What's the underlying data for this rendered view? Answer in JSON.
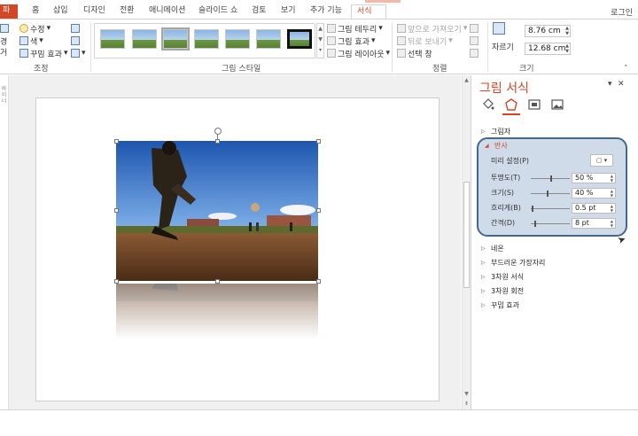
{
  "tabs": [
    {
      "label": "파일",
      "id": "file"
    },
    {
      "label": "홈",
      "id": "home"
    },
    {
      "label": "삽입",
      "id": "insert"
    },
    {
      "label": "디자인",
      "id": "design"
    },
    {
      "label": "전환",
      "id": "transitions"
    },
    {
      "label": "애니메이션",
      "id": "animations"
    },
    {
      "label": "슬라이드 쇼",
      "id": "slideshow"
    },
    {
      "label": "검토",
      "id": "review"
    },
    {
      "label": "보기",
      "id": "view"
    },
    {
      "label": "추가 기능",
      "id": "addins"
    },
    {
      "label": "서식",
      "id": "format"
    }
  ],
  "login_label": "로그인",
  "ribbon": {
    "adjust": {
      "label": "조정",
      "left_partial": [
        "경",
        "거"
      ],
      "corrections": "수정",
      "color": "색",
      "artistic": "꾸밈 효과"
    },
    "styles": {
      "label": "그림 스타일",
      "border": "그림 테두리",
      "effects": "그림 효과",
      "layout": "그림 레이아웃"
    },
    "arrange": {
      "label": "정렬",
      "bring_forward": "앞으로 가져오기",
      "send_backward": "뒤로 보내기",
      "selection_pane": "선택 창"
    },
    "size": {
      "label": "크기",
      "crop": "자르기",
      "height": "8.76 cm",
      "width": "12.68 cm"
    }
  },
  "left_strip_text": "바이너",
  "pane": {
    "title": "그림 서식",
    "close": "✕",
    "menu": "▾",
    "sections_top": [
      {
        "label": "그림자"
      }
    ],
    "reflection": {
      "label": "반사",
      "preset_label": "미리 설정(P)",
      "rows": [
        {
          "label": "투명도(T)",
          "value": "50 %",
          "fraction": 0.5
        },
        {
          "label": "크기(S)",
          "value": "40 %",
          "fraction": 0.4
        },
        {
          "label": "흐리게(B)",
          "value": "0.5 pt",
          "fraction": 0.02
        },
        {
          "label": "간격(D)",
          "value": "8 pt",
          "fraction": 0.08
        }
      ]
    },
    "sections_bottom": [
      {
        "label": "네온"
      },
      {
        "label": "부드러운 가장자리"
      },
      {
        "label": "3차원 서식"
      },
      {
        "label": "3차원 회전"
      },
      {
        "label": "꾸밈 효과"
      }
    ]
  },
  "colors": {
    "accent": "#d24726",
    "highlight_border": "#43688f",
    "highlight_fill": "#cfdbe9"
  }
}
